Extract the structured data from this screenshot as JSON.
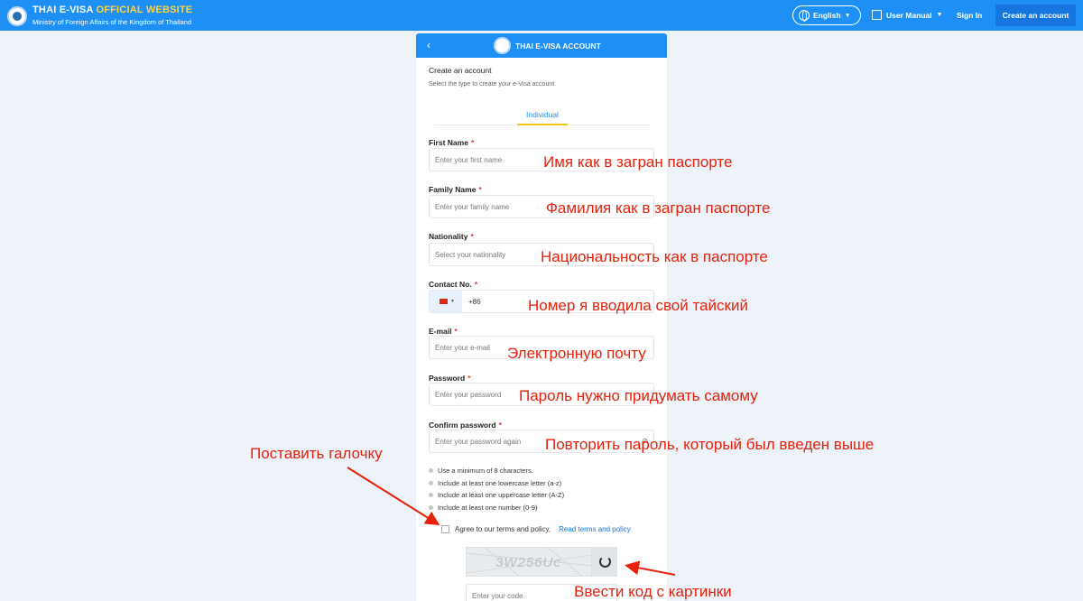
{
  "header": {
    "brand_title_main": "THAI E-VISA",
    "brand_title_accent": "OFFICIAL WEBSITE",
    "brand_subtitle": "Ministry of Foreign Affairs of the Kingdom of Thailand",
    "language": "English",
    "user_manual": "User Manual",
    "sign_in": "Sign In",
    "create_account": "Create an account"
  },
  "card": {
    "title": "THAI E-VISA ACCOUNT",
    "heading": "Create an account",
    "subheading": "Select the type to create your e-Visa account",
    "tab": "Individual",
    "fields": {
      "first_name": {
        "label": "First Name",
        "placeholder": "Enter your first name"
      },
      "family_name": {
        "label": "Family Name",
        "placeholder": "Enter your family name"
      },
      "nationality": {
        "label": "Nationality",
        "placeholder": "Select your nationality"
      },
      "contact": {
        "label": "Contact No.",
        "code": "+86"
      },
      "email": {
        "label": "E-mail",
        "placeholder": "Enter your e-mail"
      },
      "password": {
        "label": "Password",
        "placeholder": "Enter your password"
      },
      "confirm": {
        "label": "Confirm password",
        "placeholder": "Enter your password again"
      }
    },
    "rules": [
      "Use a minimum of 8 characters.",
      "Include at least one lowercase letter (a-z)",
      "Include at least one uppercase letter (A-Z)",
      "Include at least one number (0-9)"
    ],
    "agree_text": "Agree to our terms and policy,",
    "agree_link": "Read terms and policy",
    "captcha_text": "3W256Uc",
    "code_placeholder": "Enter your code"
  },
  "annotations": {
    "first_name": "Имя как в загран паспорте",
    "family_name": "Фамилия как в загран паспорте",
    "nationality": "Национальность как в паспорте",
    "contact": "Номер я вводила свой тайский",
    "email": "Электронную почту",
    "password": "Пароль нужно придумать самому",
    "confirm": "Повторить пароль, который был введен выше",
    "checkbox": "Поставить галочку",
    "captcha": "Ввести код с картинки"
  },
  "colors": {
    "primary": "#1e90f5",
    "accent": "#ffd33d",
    "annotation": "#e8210c"
  }
}
